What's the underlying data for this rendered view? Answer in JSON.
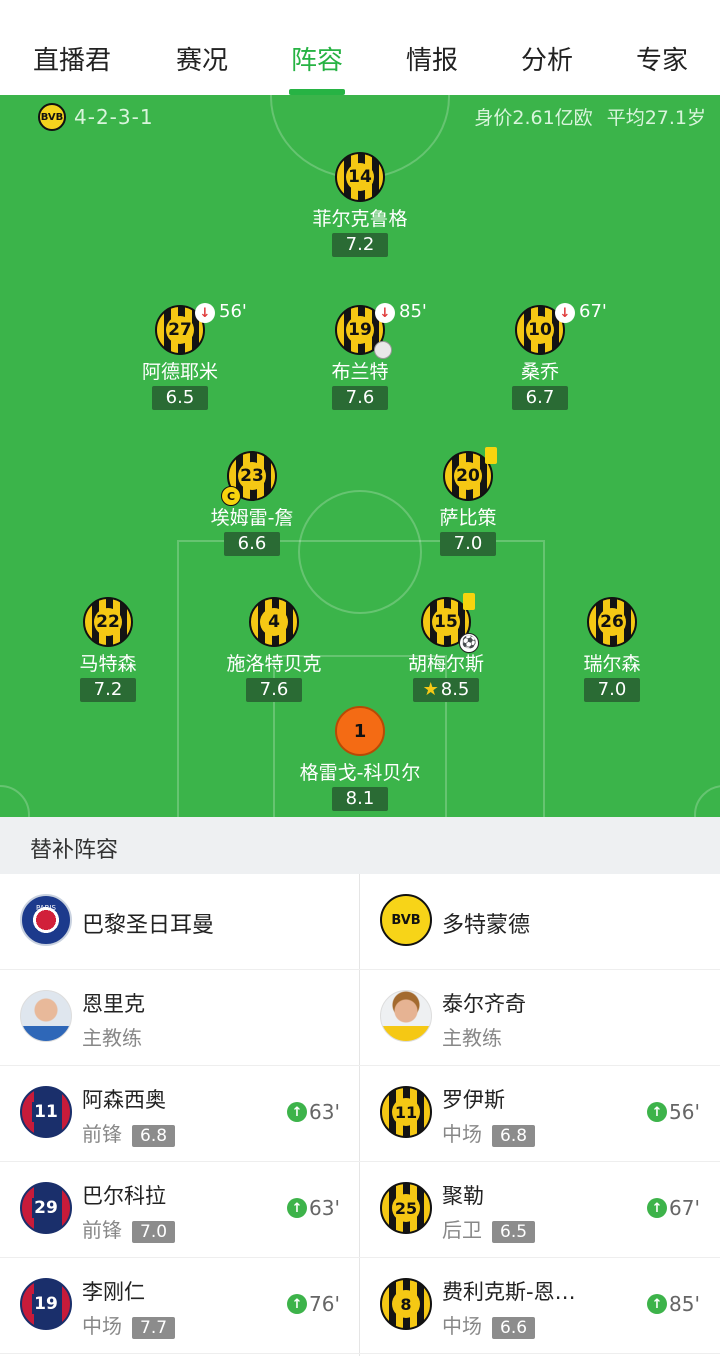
{
  "tabs": [
    "直播君",
    "赛况",
    "阵容",
    "情报",
    "分析",
    "专家"
  ],
  "active_tab": "阵容",
  "lineup": {
    "formation": "4-2-3-1",
    "team_badge": "BVB",
    "market_value": "身价2.61亿欧",
    "avg_age": "平均27.1岁",
    "players": [
      {
        "num": "14",
        "name": "菲尔克鲁格",
        "rating": "7.2"
      },
      {
        "num": "27",
        "name": "阿德耶米",
        "rating": "6.5",
        "sub_out": "56'"
      },
      {
        "num": "19",
        "name": "布兰特",
        "rating": "7.6",
        "sub_out": "85'"
      },
      {
        "num": "10",
        "name": "桑乔",
        "rating": "6.7",
        "sub_out": "67'"
      },
      {
        "num": "23",
        "name": "埃姆雷-詹",
        "rating": "6.6",
        "captain": "C"
      },
      {
        "num": "20",
        "name": "萨比策",
        "rating": "7.0"
      },
      {
        "num": "22",
        "name": "马特森",
        "rating": "7.2"
      },
      {
        "num": "4",
        "name": "施洛特贝克",
        "rating": "7.6"
      },
      {
        "num": "15",
        "name": "胡梅尔斯",
        "rating": "8.5"
      },
      {
        "num": "26",
        "name": "瑞尔森",
        "rating": "7.0"
      },
      {
        "num": "1",
        "name": "格雷戈-科贝尔",
        "rating": "8.1"
      }
    ]
  },
  "subs": {
    "title": "替补阵容",
    "home": {
      "team": "巴黎圣日耳曼",
      "crest_text": "PARIS",
      "coach_name": "恩里克",
      "coach_role": "主教练",
      "players": [
        {
          "num": "11",
          "name": "阿森西奥",
          "pos": "前锋",
          "rating": "6.8",
          "time": "63'"
        },
        {
          "num": "29",
          "name": "巴尔科拉",
          "pos": "前锋",
          "rating": "7.0",
          "time": "63'"
        },
        {
          "num": "19",
          "name": "李刚仁",
          "pos": "中场",
          "rating": "7.7",
          "time": "76'"
        }
      ]
    },
    "away": {
      "team": "多特蒙德",
      "crest_text": "BVB",
      "coach_name": "泰尔齐奇",
      "coach_role": "主教练",
      "players": [
        {
          "num": "11",
          "name": "罗伊斯",
          "pos": "中场",
          "rating": "6.8",
          "time": "56'"
        },
        {
          "num": "25",
          "name": "聚勒",
          "pos": "后卫",
          "rating": "6.5",
          "time": "67'"
        },
        {
          "num": "8",
          "name": "费利克斯-恩…",
          "pos": "中场",
          "rating": "6.6",
          "time": "85'"
        }
      ]
    }
  },
  "colors": {
    "accent": "#27b344",
    "pitch": "#3bb44a",
    "bvb_yellow": "#f5c814"
  }
}
